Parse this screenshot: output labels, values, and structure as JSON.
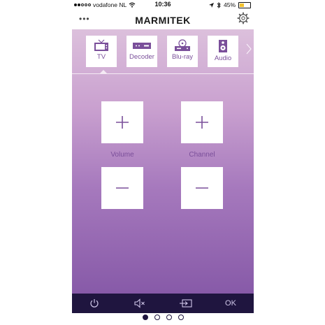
{
  "status_bar": {
    "carrier": "vodafone NL",
    "time": "10:36",
    "battery": "45%",
    "battery_fraction": 0.45,
    "signal_bars_filled": 2,
    "signal_bars_total": 5
  },
  "header": {
    "brand": "MARMITEK",
    "menu_icon": "more-dots-icon",
    "settings_icon": "gear-icon"
  },
  "devices": [
    {
      "label": "TV",
      "icon": "tv-icon",
      "active": true
    },
    {
      "label": "Decoder",
      "icon": "decoder-icon",
      "active": false
    },
    {
      "label": "Blu-ray",
      "icon": "bluray-icon",
      "active": false
    },
    {
      "label": "Audio",
      "icon": "speaker-icon",
      "active": false
    }
  ],
  "controls": {
    "volume_label": "Volume",
    "channel_label": "Channel"
  },
  "toolbar": {
    "power_icon": "power-icon",
    "mute_icon": "mute-icon",
    "input_icon": "input-source-icon",
    "ok_label": "OK"
  },
  "pager": {
    "pages": 4,
    "active": 0
  },
  "colors": {
    "accent_text": "#7a4f9a",
    "toolbar_bg": "#1f153f",
    "gradient_top": "#dcc0dc",
    "gradient_bottom": "#875aa8"
  }
}
